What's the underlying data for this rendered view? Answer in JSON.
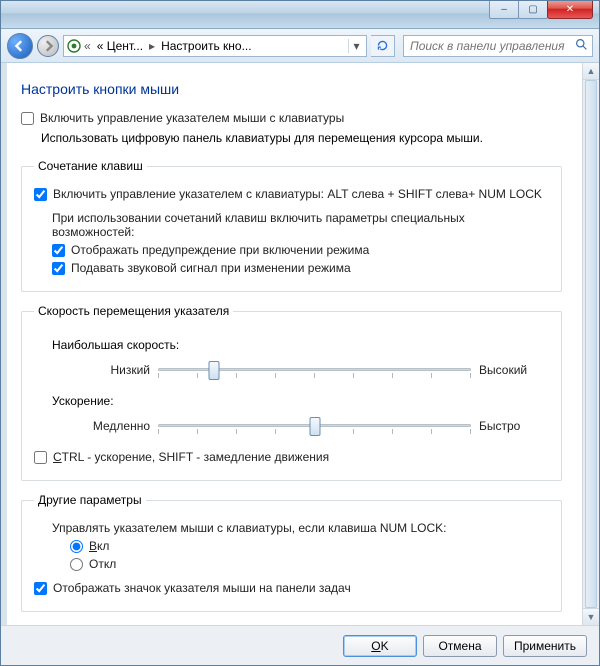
{
  "titlebar": {
    "minimize": "–",
    "maximize": "▢",
    "close": "✕"
  },
  "nav": {
    "crumb1": "« Цент...",
    "crumb2": "Настроить кно...",
    "search_placeholder": "Поиск в панели управления"
  },
  "page": {
    "title": "Настроить кнопки мыши",
    "enable_keyboard_pointer": "Включить управление указателем мыши с клавиатуры",
    "description": "Использовать цифровую панель клавиатуры для перемещения курсора мыши."
  },
  "shortcuts": {
    "legend": "Сочетание клавиш",
    "enable_shortcut": "Включить управление указателем с клавиатуры: ALT слева + SHIFT слева+ NUM LOCK",
    "on_use_text": "При использовании сочетаний клавиш включить параметры специальных возможностей:",
    "show_warning": "Отображать предупреждение при включении режима",
    "play_sound": "Подавать звуковой сигнал при изменении режима"
  },
  "speed": {
    "legend": "Скорость перемещения указателя",
    "max_speed_label": "Наибольшая скорость:",
    "low": "Низкий",
    "high": "Высокий",
    "accel_label": "Ускорение:",
    "slow": "Медленно",
    "fast": "Быстро",
    "ctrl_shift_prefix": "C",
    "ctrl_shift_rest": "TRL - ускорение, SHIFT - замедление движения"
  },
  "other": {
    "legend": "Другие параметры",
    "numlock_text": "Управлять указателем мыши с клавиатуры, если клавиша NUM LOCK:",
    "on_prefix": "В",
    "on_rest": "кл",
    "off": "Откл",
    "show_tray_icon": "Отображать значок указателя мыши на панели задач"
  },
  "footer": {
    "ok_prefix": "O",
    "ok_rest": "K",
    "cancel": "Отмена",
    "apply": "Применить"
  },
  "state": {
    "speed_thumb_percent": 18,
    "accel_thumb_percent": 50
  }
}
